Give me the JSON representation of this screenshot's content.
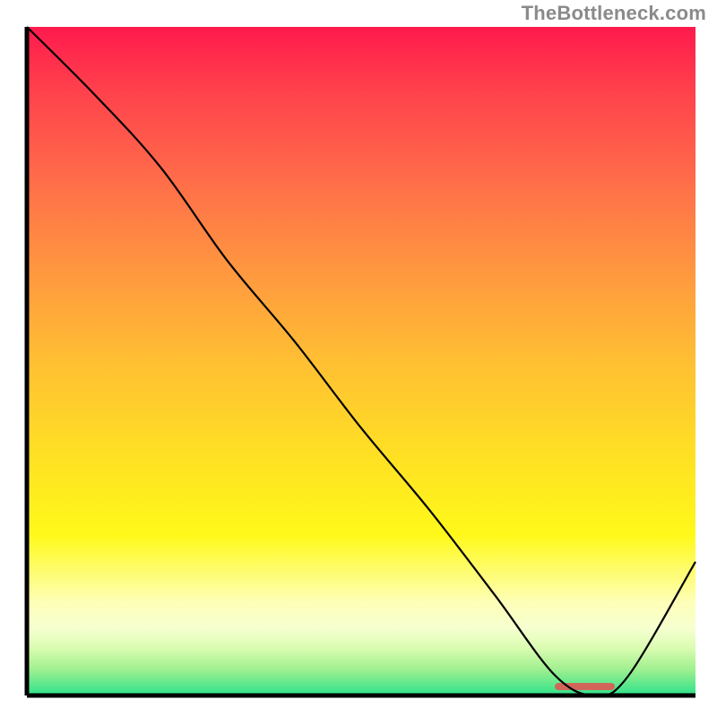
{
  "attribution": "TheBottleneck.com",
  "chart_data": {
    "type": "line",
    "title": "",
    "xlabel": "",
    "ylabel": "",
    "xlim": [
      0,
      100
    ],
    "ylim": [
      0,
      100
    ],
    "x": [
      0,
      10,
      20,
      30,
      40,
      50,
      60,
      70,
      79,
      85,
      90,
      100
    ],
    "values": [
      100,
      90,
      79,
      65,
      53,
      40,
      28,
      15,
      3,
      0,
      3,
      20
    ],
    "optimum_range": [
      79,
      88
    ],
    "gradient_note": "background encodes bottleneck severity: top=red (high), bottom=green (low)"
  },
  "icons": {},
  "colors": {
    "curve": "#000000",
    "marker": "#d2655a",
    "axis": "#000000"
  }
}
